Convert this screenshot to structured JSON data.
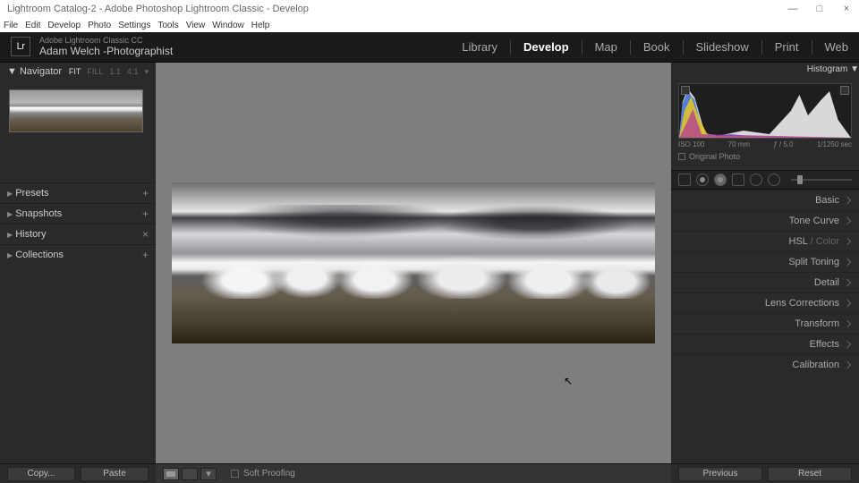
{
  "window": {
    "title": "Lightroom Catalog-2 - Adobe Photoshop Lightroom Classic - Develop"
  },
  "menu": [
    "File",
    "Edit",
    "Develop",
    "Photo",
    "Settings",
    "Tools",
    "View",
    "Window",
    "Help"
  ],
  "identity": {
    "product": "Adobe Lightroom Classic CC",
    "user": "Adam Welch -Photographist"
  },
  "modules": [
    {
      "label": "Library",
      "active": false
    },
    {
      "label": "Develop",
      "active": true
    },
    {
      "label": "Map",
      "active": false
    },
    {
      "label": "Book",
      "active": false
    },
    {
      "label": "Slideshow",
      "active": false
    },
    {
      "label": "Print",
      "active": false
    },
    {
      "label": "Web",
      "active": false
    }
  ],
  "leftPanel": {
    "navigator": {
      "title": "Navigator",
      "zoom": [
        "FIT",
        "FILL",
        "1:1",
        "4:1"
      ],
      "zoomActive": "FIT"
    },
    "sections": [
      {
        "label": "Presets",
        "suffix": "+"
      },
      {
        "label": "Snapshots",
        "suffix": "+"
      },
      {
        "label": "History",
        "suffix": "×"
      },
      {
        "label": "Collections",
        "suffix": "+"
      }
    ],
    "buttons": {
      "copy": "Copy...",
      "paste": "Paste"
    }
  },
  "rightPanel": {
    "histogram": {
      "title": "Histogram",
      "iso": "ISO 100",
      "focal": "70 mm",
      "aperture": "ƒ / 5.0",
      "shutter": "1/1250 sec",
      "original": "Original Photo"
    },
    "sections": [
      "Basic",
      "Tone Curve",
      "HSL / Color",
      "Split Toning",
      "Detail",
      "Lens Corrections",
      "Transform",
      "Effects",
      "Calibration"
    ],
    "buttons": {
      "previous": "Previous",
      "reset": "Reset"
    }
  },
  "toolbar": {
    "softProofing": "Soft Proofing"
  }
}
